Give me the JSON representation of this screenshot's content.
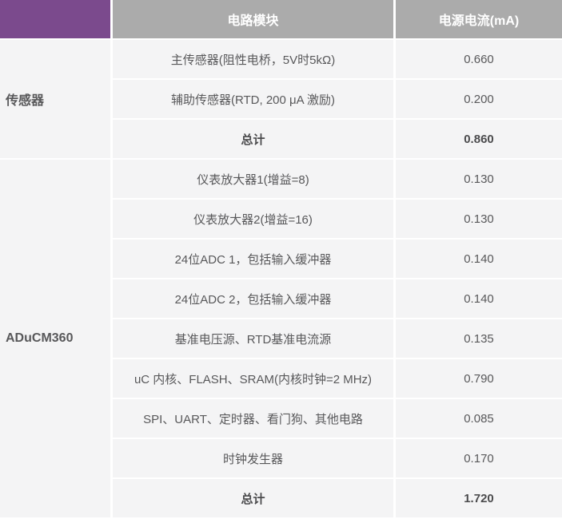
{
  "colors": {
    "header_purple": "#7B4A8D",
    "header_gray": "#ABABAB",
    "cell_bg": "#F4F4F5",
    "cell_text": "#58585A"
  },
  "table": {
    "columns": {
      "module": "电路模块",
      "current": "电源电流(mA)"
    },
    "groups": [
      {
        "label": "传感器",
        "rows": [
          {
            "module": "主传感器(阻性电桥，5V时5kΩ)",
            "current": "0.660",
            "total": false
          },
          {
            "module": "辅助传感器(RTD, 200 μA 激励)",
            "current": "0.200",
            "total": false
          },
          {
            "module": "总计",
            "current": "0.860",
            "total": true
          }
        ]
      },
      {
        "label": "ADuCM360",
        "rows": [
          {
            "module": "仪表放大器1(增益=8)",
            "current": "0.130",
            "total": false
          },
          {
            "module": "仪表放大器2(增益=16)",
            "current": "0.130",
            "total": false
          },
          {
            "module": "24位ADC 1，包括输入缓冲器",
            "current": "0.140",
            "total": false
          },
          {
            "module": "24位ADC 2，包括输入缓冲器",
            "current": "0.140",
            "total": false
          },
          {
            "module": "基准电压源、RTD基准电流源",
            "current": "0.135",
            "total": false
          },
          {
            "module": "uC 内核、FLASH、SRAM(内核时钟=2 MHz)",
            "current": "0.790",
            "total": false
          },
          {
            "module": "SPI、UART、定时器、看门狗、其他电路",
            "current": "0.085",
            "total": false
          },
          {
            "module": "时钟发生器",
            "current": "0.170",
            "total": false
          },
          {
            "module": "总计",
            "current": "1.720",
            "total": true
          }
        ]
      }
    ]
  }
}
